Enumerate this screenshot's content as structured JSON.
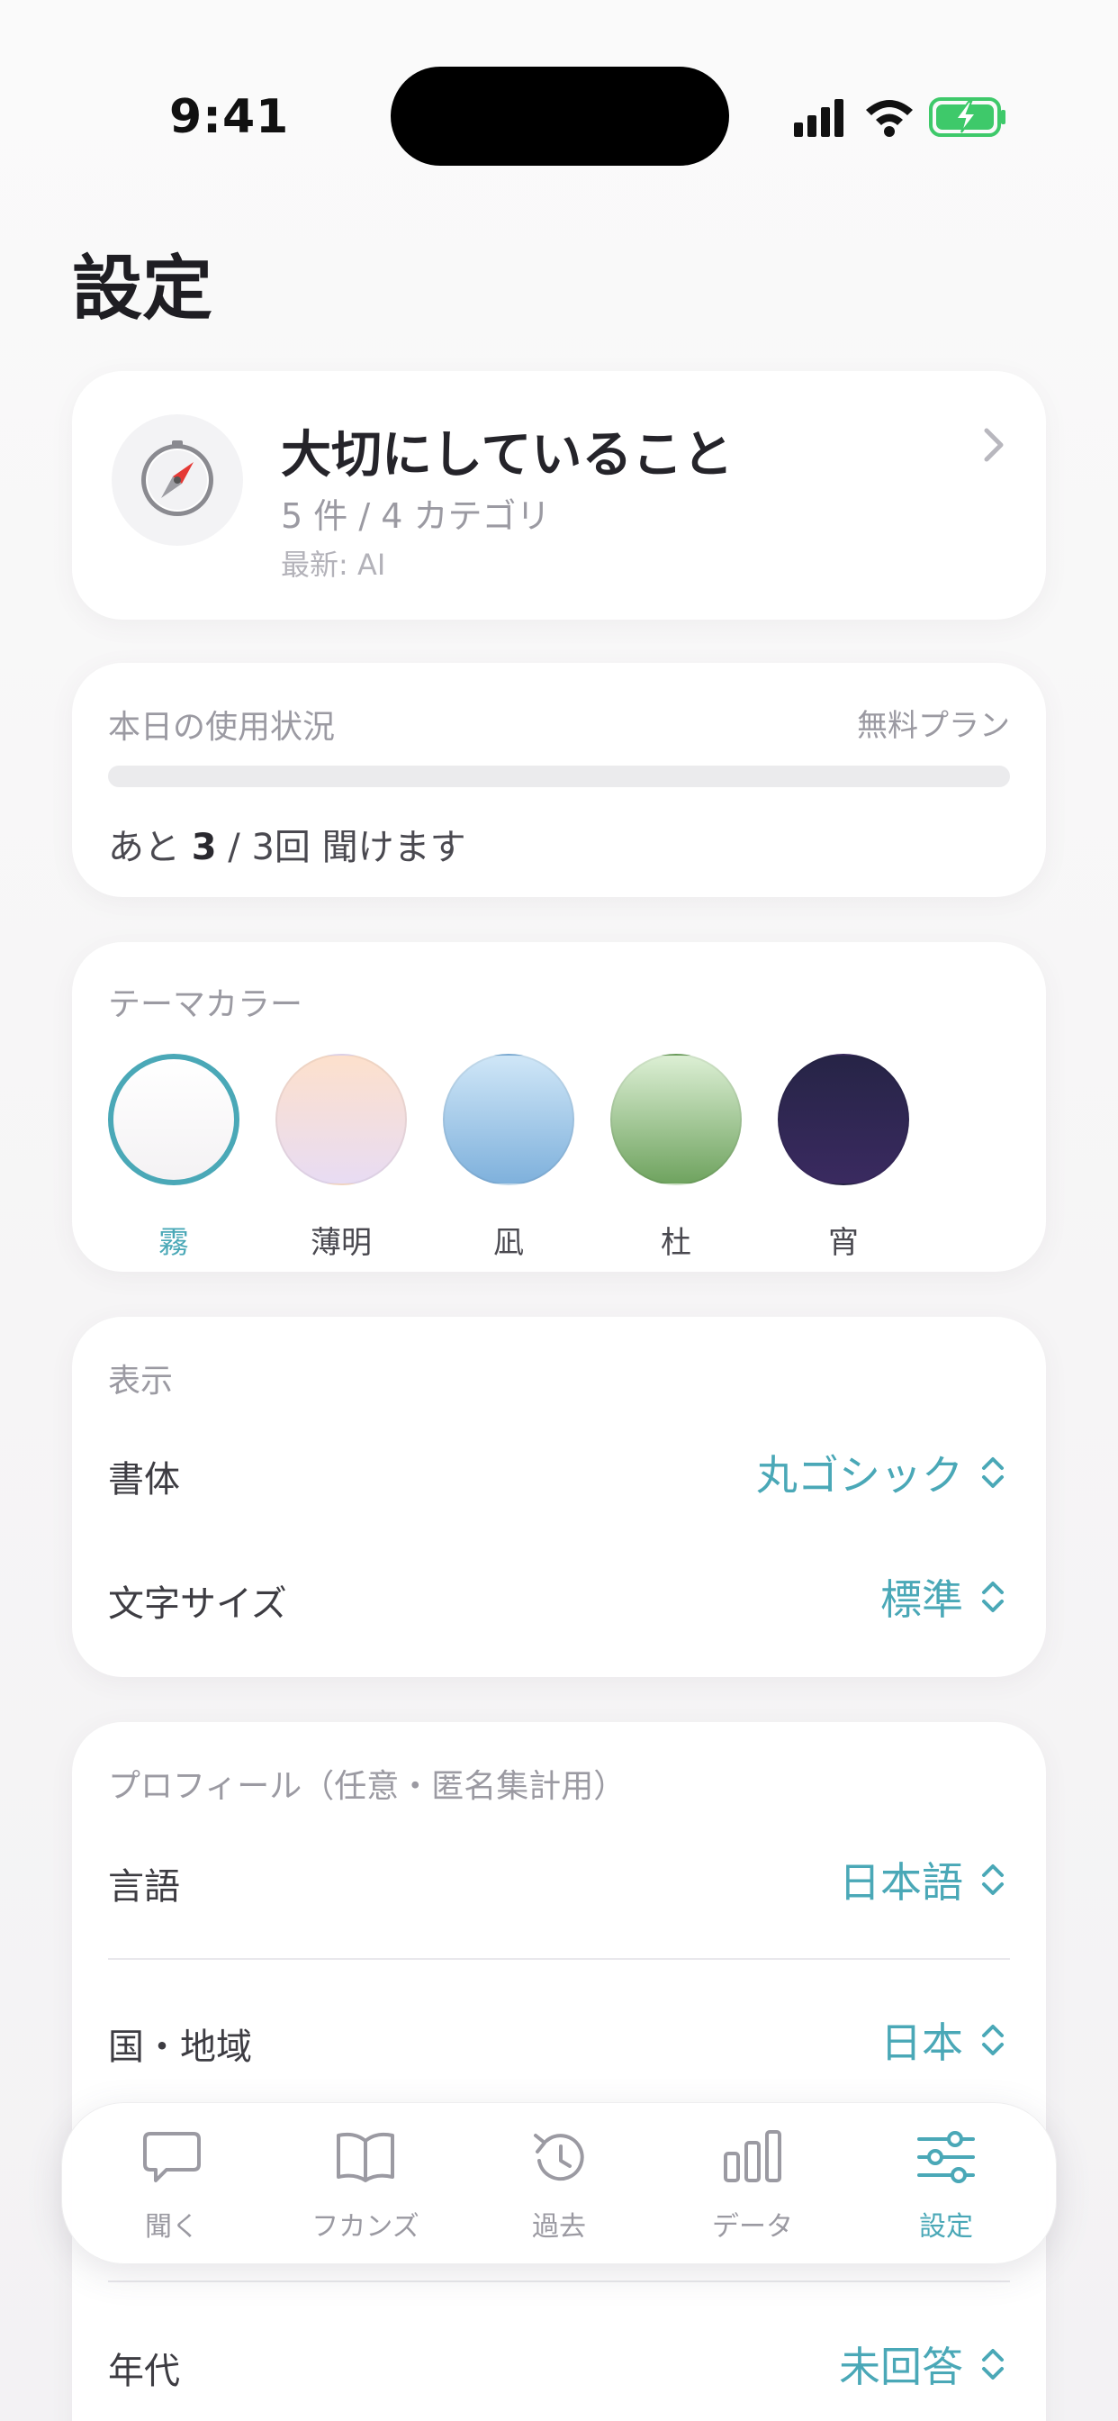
{
  "status_bar": {
    "time": "9:41"
  },
  "page_title": "設定",
  "values_card": {
    "title": "大切にしていること",
    "subtitle": "5 件 / 4 カテゴリ",
    "latest": "最新: AI",
    "icon": "compass-icon"
  },
  "usage": {
    "label": "本日の使用状況",
    "plan": "無料プラン",
    "prefix": "あと ",
    "remaining": "3",
    "suffix": " / 3回 聞けます",
    "used_fraction": 0
  },
  "theme": {
    "label": "テーマカラー",
    "swatches": [
      {
        "name": "霧",
        "selected": true,
        "top": "#ffffff",
        "bottom": "#f4f2f4",
        "accent": "#4aa8b7"
      },
      {
        "name": "薄明",
        "selected": false,
        "top": "#fde0cc",
        "bottom": "#e8dcf3"
      },
      {
        "name": "凪",
        "selected": false,
        "top": "#cfe6f7",
        "bottom": "#7fb1dc"
      },
      {
        "name": "杜",
        "selected": false,
        "top": "#dcefd4",
        "bottom": "#6fa35f"
      },
      {
        "name": "宵",
        "selected": false,
        "top": "#262446",
        "bottom": "#3a2a60"
      }
    ]
  },
  "display": {
    "label": "表示",
    "font": {
      "label": "書体",
      "value": "丸ゴシック"
    },
    "text_size": {
      "label": "文字サイズ",
      "value": "標準"
    }
  },
  "profile": {
    "label": "プロフィール（任意・匿名集計用）",
    "language": {
      "label": "言語",
      "value": "日本語"
    },
    "region": {
      "label": "国・地域",
      "value": "日本"
    },
    "age": {
      "label": "年代",
      "value": "未回答"
    }
  },
  "tabbar": {
    "tabs": [
      {
        "label": "聞く",
        "icon": "chat-bubble-icon",
        "active": false
      },
      {
        "label": "フカンズ",
        "icon": "book-icon",
        "active": false
      },
      {
        "label": "過去",
        "icon": "history-icon",
        "active": false
      },
      {
        "label": "データ",
        "icon": "bar-chart-icon",
        "active": false
      },
      {
        "label": "設定",
        "icon": "sliders-icon",
        "active": true
      }
    ]
  },
  "colors": {
    "accent": "#4aa8b7",
    "muted_text": "#9b9aa2",
    "card": "#ffffff"
  }
}
